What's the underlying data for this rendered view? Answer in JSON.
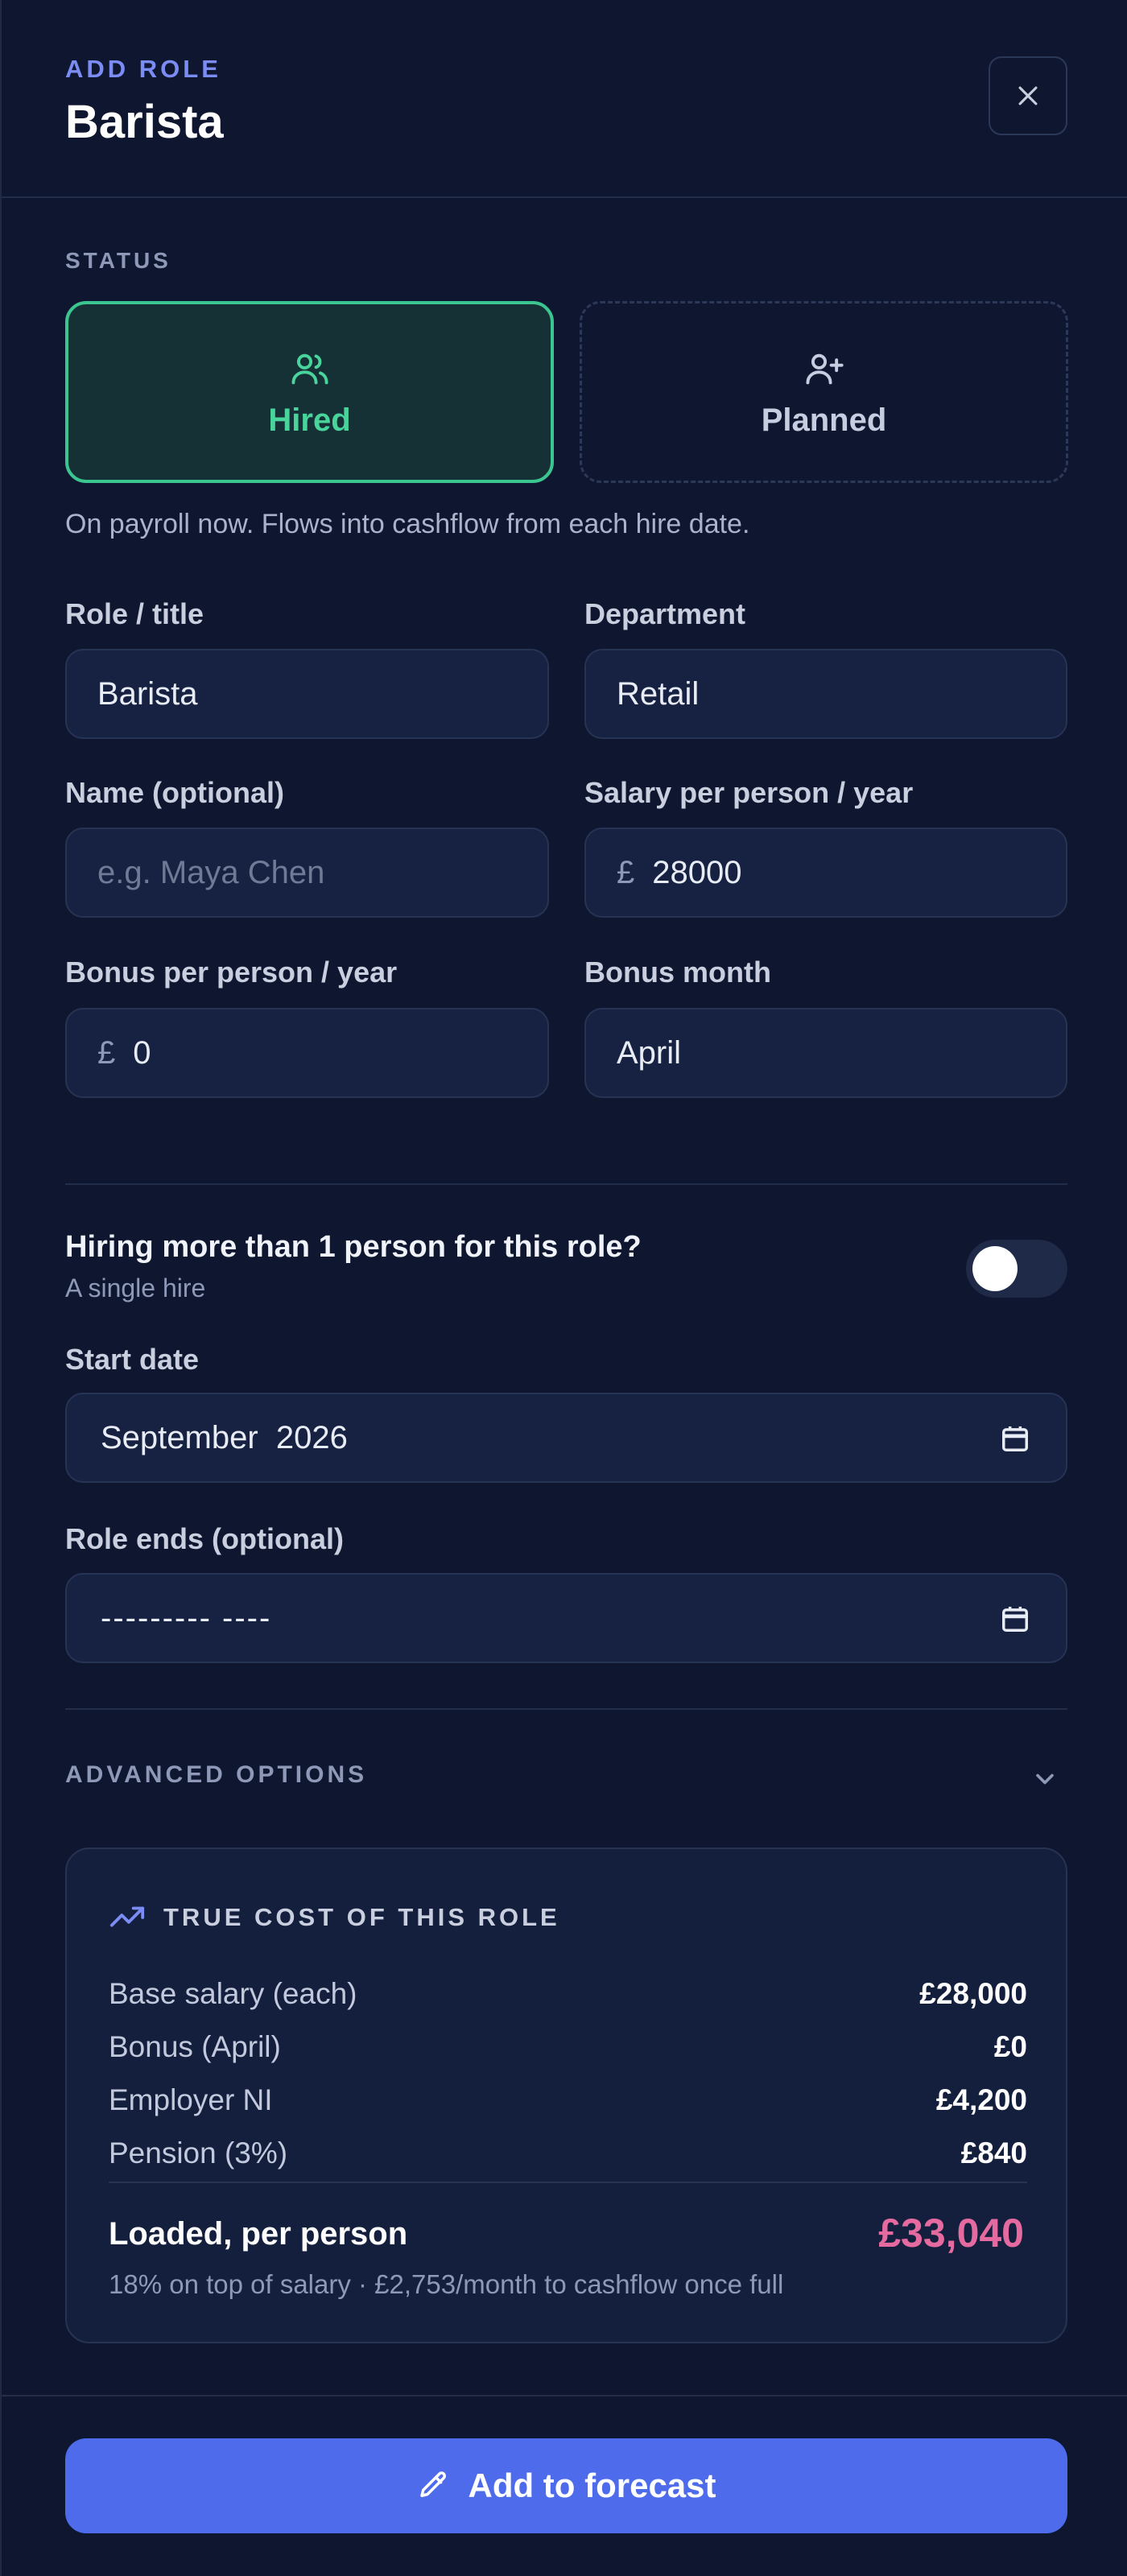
{
  "header": {
    "eyebrow": "ADD ROLE",
    "title": "Barista"
  },
  "status": {
    "label": "STATUS",
    "options": [
      {
        "label": "Hired",
        "icon": "users-icon",
        "selected": true,
        "accent": "#3bc691"
      },
      {
        "label": "Planned",
        "icon": "user-plus-icon",
        "selected": false
      }
    ],
    "help": "On payroll now. Flows into cashflow from each hire date."
  },
  "fields": {
    "role_title": {
      "label": "Role / title",
      "value": "Barista"
    },
    "department": {
      "label": "Department",
      "value": "Retail"
    },
    "name": {
      "label": "Name (optional)",
      "placeholder": "e.g. Maya Chen",
      "value": ""
    },
    "salary": {
      "label": "Salary per person / year",
      "currency": "£",
      "value": "28000"
    },
    "bonus": {
      "label": "Bonus per person / year",
      "currency": "£",
      "value": "0"
    },
    "bonus_month": {
      "label": "Bonus month",
      "value": "April"
    },
    "start_date": {
      "label": "Start date",
      "value": "September  2026"
    },
    "role_ends": {
      "label": "Role ends (optional)",
      "value": "--------- ----"
    }
  },
  "multi_hire": {
    "title": "Hiring more than 1 person for this role?",
    "subtitle": "A single hire",
    "enabled": false
  },
  "advanced": {
    "label": "ADVANCED OPTIONS"
  },
  "cost": {
    "title": "TRUE COST OF THIS ROLE",
    "rows": [
      {
        "label": "Base salary (each)",
        "value": "£28,000"
      },
      {
        "label": "Bonus (April)",
        "value": "£0"
      },
      {
        "label": "Employer NI",
        "value": "£4,200"
      },
      {
        "label": "Pension (3%)",
        "value": "£840"
      }
    ],
    "loaded_label": "Loaded, per person",
    "loaded_value": "£33,040",
    "note": "18% on top of salary · £2,753/month to cashflow once full"
  },
  "actions": {
    "submit_label": "Add to forecast"
  },
  "colors": {
    "background": "#0f1730",
    "accent": "#4e6bec",
    "hired": "#3bc691",
    "loaded": "#e56aa0",
    "eyebrow": "#7b8cf5"
  }
}
